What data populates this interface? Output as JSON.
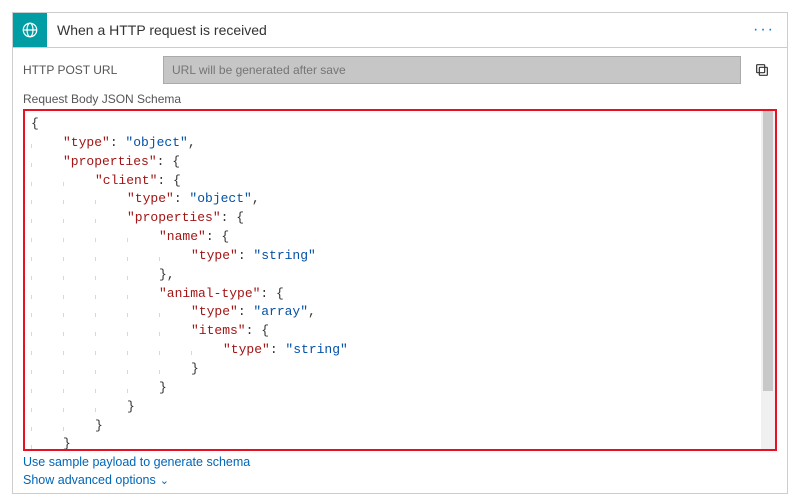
{
  "header": {
    "title": "When a HTTP request is received",
    "icon": "globe-request-icon",
    "more": "···"
  },
  "url_row": {
    "label": "HTTP POST URL",
    "placeholder": "URL will be generated after save"
  },
  "schema_section": {
    "label": "Request Body JSON Schema"
  },
  "links": {
    "sample_payload": "Use sample payload to generate schema",
    "advanced": "Show advanced options"
  },
  "colors": {
    "brand": "#009da5",
    "link": "#0066b8",
    "highlight_border": "#e81123"
  },
  "schema_tokens": [
    [
      {
        "t": "p",
        "v": "{"
      }
    ],
    [
      {
        "ind": 1
      },
      {
        "t": "k",
        "v": "\"type\""
      },
      {
        "t": "p",
        "v": ": "
      },
      {
        "t": "s",
        "v": "\"object\""
      },
      {
        "t": "p",
        "v": ","
      }
    ],
    [
      {
        "ind": 1
      },
      {
        "t": "k",
        "v": "\"properties\""
      },
      {
        "t": "p",
        "v": ": {"
      }
    ],
    [
      {
        "ind": 2
      },
      {
        "t": "k",
        "v": "\"client\""
      },
      {
        "t": "p",
        "v": ": {"
      }
    ],
    [
      {
        "ind": 3
      },
      {
        "t": "k",
        "v": "\"type\""
      },
      {
        "t": "p",
        "v": ": "
      },
      {
        "t": "s",
        "v": "\"object\""
      },
      {
        "t": "p",
        "v": ","
      }
    ],
    [
      {
        "ind": 3
      },
      {
        "t": "k",
        "v": "\"properties\""
      },
      {
        "t": "p",
        "v": ": {"
      }
    ],
    [
      {
        "ind": 4
      },
      {
        "t": "k",
        "v": "\"name\""
      },
      {
        "t": "p",
        "v": ": {"
      }
    ],
    [
      {
        "ind": 5
      },
      {
        "t": "k",
        "v": "\"type\""
      },
      {
        "t": "p",
        "v": ": "
      },
      {
        "t": "s",
        "v": "\"string\""
      }
    ],
    [
      {
        "ind": 4
      },
      {
        "t": "p",
        "v": "},"
      }
    ],
    [
      {
        "ind": 4
      },
      {
        "t": "k",
        "v": "\"animal-type\""
      },
      {
        "t": "p",
        "v": ": {"
      }
    ],
    [
      {
        "ind": 5
      },
      {
        "t": "k",
        "v": "\"type\""
      },
      {
        "t": "p",
        "v": ": "
      },
      {
        "t": "s",
        "v": "\"array\""
      },
      {
        "t": "p",
        "v": ","
      }
    ],
    [
      {
        "ind": 5
      },
      {
        "t": "k",
        "v": "\"items\""
      },
      {
        "t": "p",
        "v": ": {"
      }
    ],
    [
      {
        "ind": 6
      },
      {
        "t": "k",
        "v": "\"type\""
      },
      {
        "t": "p",
        "v": ": "
      },
      {
        "t": "s",
        "v": "\"string\""
      }
    ],
    [
      {
        "ind": 5
      },
      {
        "t": "p",
        "v": "}"
      }
    ],
    [
      {
        "ind": 4
      },
      {
        "t": "p",
        "v": "}"
      }
    ],
    [
      {
        "ind": 3
      },
      {
        "t": "p",
        "v": "}"
      }
    ],
    [
      {
        "ind": 2
      },
      {
        "t": "p",
        "v": "}"
      }
    ],
    [
      {
        "ind": 1
      },
      {
        "t": "p",
        "v": "}"
      }
    ],
    [
      {
        "t": "p",
        "v": "}"
      }
    ]
  ]
}
